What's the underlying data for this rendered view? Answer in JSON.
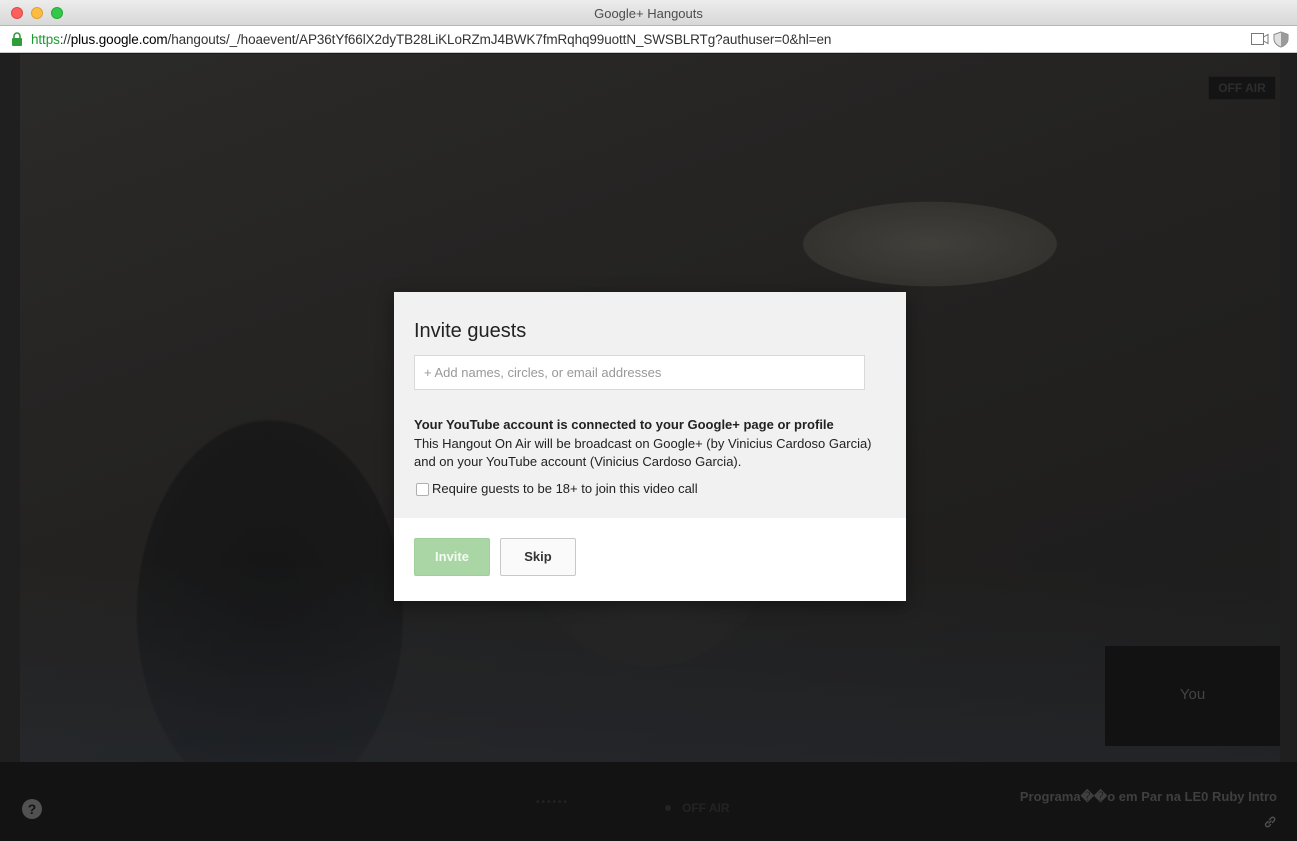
{
  "window": {
    "title": "Google+ Hangouts"
  },
  "address_bar": {
    "url_scheme": "https",
    "url_host_prefix": "://",
    "url_host": "plus.google.com",
    "url_path": "/hangouts/_/hoaevent/AP36tYf66lX2dyTB28LiKLoRZmJ4BWK7fmRqhq99uottN_SWSBLRTg?authuser=0&hl=en"
  },
  "video": {
    "off_air_badge": "OFF AIR",
    "self_view_label": "You"
  },
  "bottom_bar": {
    "help_symbol": "?",
    "status_dots": "••••••",
    "status_text": "OFF AIR",
    "event_title": "Programa��o em Par na LE0 Ruby Intro"
  },
  "dialog": {
    "title": "Invite guests",
    "input_placeholder": "+ Add names, circles, or email addresses",
    "input_value": "",
    "info_heading": "Your YouTube account is connected to your Google+ page or profile",
    "info_body": "This Hangout On Air will be broadcast on Google+ (by Vinicius Cardoso Garcia) and on your YouTube account (Vinicius Cardoso Garcia).",
    "age_checkbox_label": "Require guests to be 18+ to join this video call",
    "age_checkbox_checked": false,
    "invite_button": "Invite",
    "skip_button": "Skip"
  },
  "colors": {
    "invite_button_bg": "#a9d6a4",
    "url_scheme_color": "#1a9b2f"
  },
  "icons": {
    "lock": "lock-icon",
    "camera": "camera-icon",
    "shield": "shield-icon",
    "help": "help-icon",
    "link": "link-icon"
  }
}
